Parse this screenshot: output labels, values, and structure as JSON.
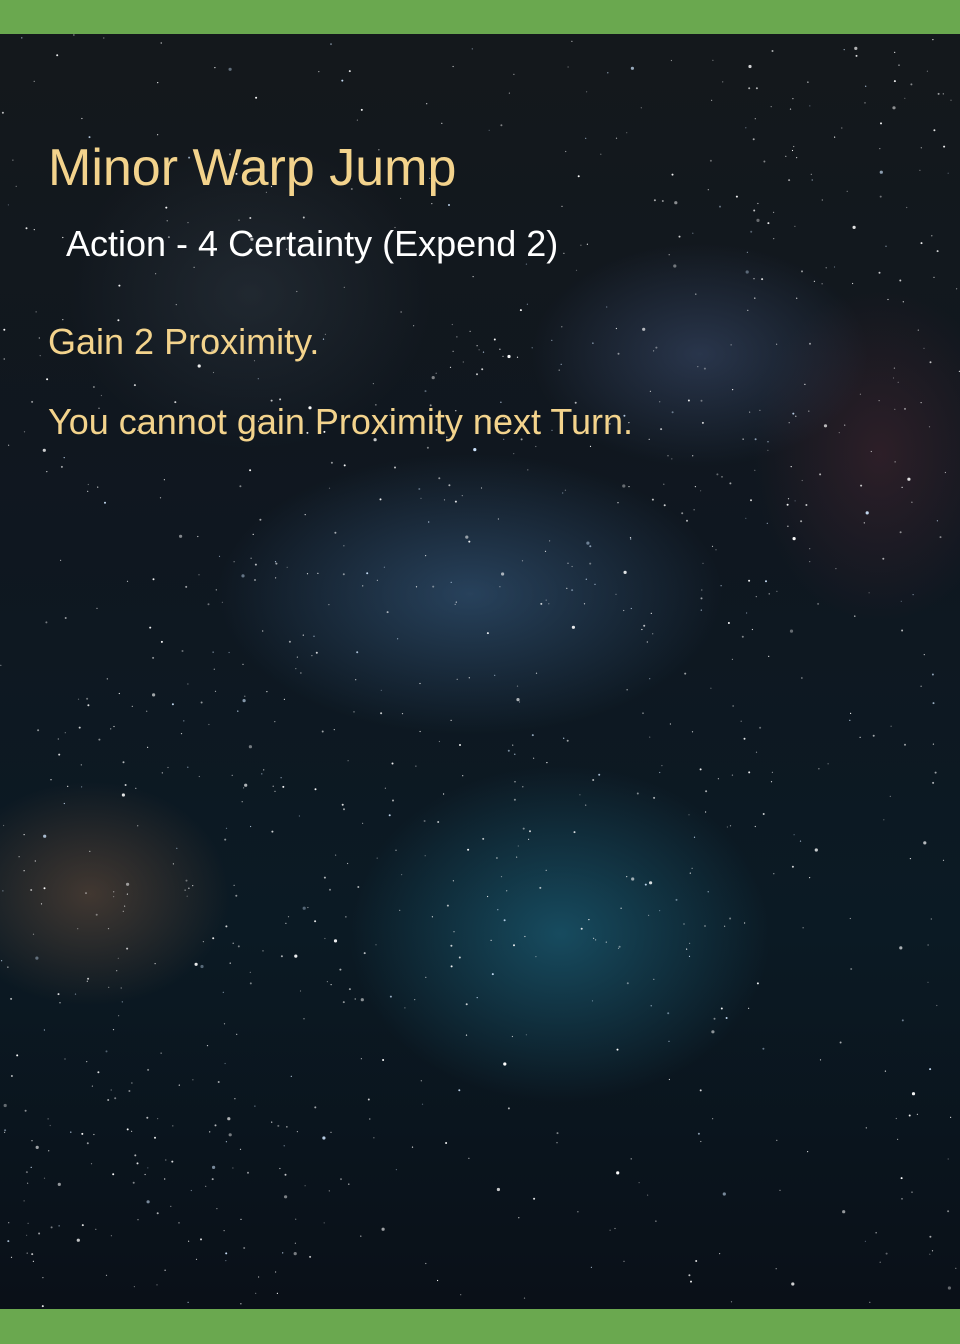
{
  "card": {
    "title": "Minor Warp Jump",
    "cost_line": "Action - 4 Certainty (Expend 2)",
    "rules": [
      "Gain 2 Proximity.",
      "You cannot gain Proximity next Turn."
    ]
  },
  "colors": {
    "frame": "#6aa84f",
    "title_text": "#f3d38c",
    "cost_text": "#ffffff",
    "rule_text": "#f3d38c"
  },
  "background": {
    "icon": "starry-sky-image"
  }
}
